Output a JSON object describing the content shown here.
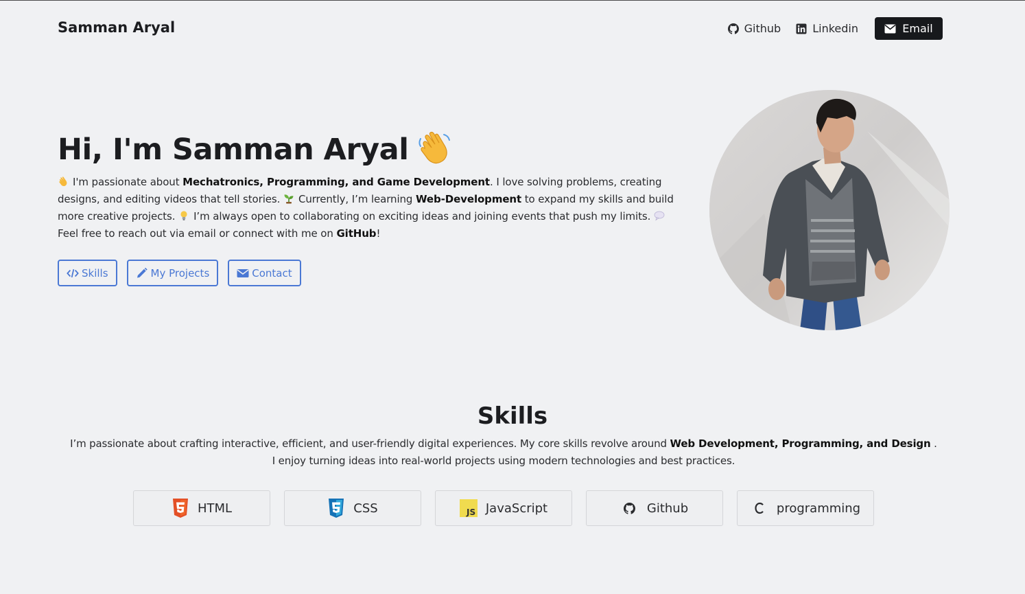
{
  "nav": {
    "brand": "Samman Aryal",
    "github_label": "Github",
    "linkedin_label": "Linkedin",
    "email_label": "Email"
  },
  "hero": {
    "title": "Hi, I'm Samman Aryal",
    "p1": "I'm passionate about ",
    "b1": "Mechatronics, Programming, and Game Development",
    "p2": ". I love solving problems, creating designs, and editing videos that tell stories.",
    "p3": "Currently, I’m learning ",
    "b2": "Web-Development",
    "p4": " to expand my skills and build more creative projects.",
    "p5": "I’m always open to collaborating on exciting ideas and joining events that push my limits.",
    "p6": "Feel free to reach out via email or connect with me on ",
    "b3": "GitHub",
    "p7": "!",
    "buttons": {
      "skills": "Skills",
      "projects": "My Projects",
      "contact": "Contact"
    }
  },
  "skills": {
    "title": "Skills",
    "t1": "I’m passionate about crafting interactive, efficient, and user-friendly digital experiences. My core skills revolve around ",
    "b1": "Web Development, Programming, and Design",
    "t2": " . I enjoy turning ideas into real-world projects using modern technologies and best practices.",
    "cards": [
      {
        "label": "HTML",
        "icon": "html5-icon"
      },
      {
        "label": "CSS",
        "icon": "css3-icon"
      },
      {
        "label": "JavaScript",
        "icon": "js-icon"
      },
      {
        "label": "Github",
        "icon": "github-icon"
      },
      {
        "label": "programming",
        "icon": "c-letter-icon"
      }
    ]
  },
  "colors": {
    "accent": "#4a78d4",
    "dark": "#17191c",
    "background": "#f0f1f3"
  }
}
